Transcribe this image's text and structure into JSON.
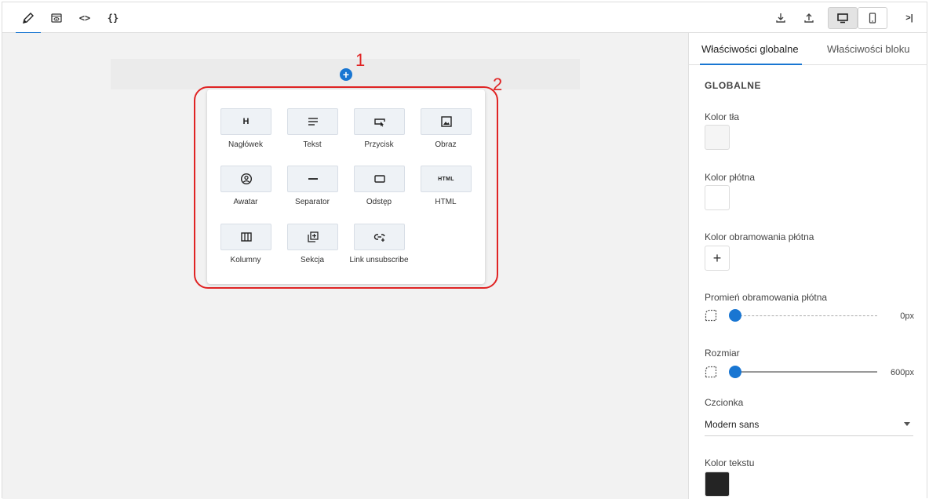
{
  "toolbar": {
    "left_buttons": [
      {
        "icon": "pencil-icon",
        "label": "edit"
      },
      {
        "icon": "eye-icon",
        "label": "preview"
      },
      {
        "icon": "html-code-icon",
        "glyph": "<>"
      },
      {
        "icon": "json-code-icon",
        "glyph": "{}"
      }
    ],
    "right_buttons": [
      {
        "icon": "download-icon"
      },
      {
        "icon": "upload-icon"
      },
      {
        "icon": "desktop-icon",
        "selected": true
      },
      {
        "icon": "mobile-icon"
      },
      {
        "icon": "collapse-panel-icon",
        "glyph": ">|"
      }
    ]
  },
  "canvas": {
    "add_symbol": "+",
    "annotations": {
      "marker_1": "1",
      "marker_2": "2"
    },
    "blocks": [
      {
        "label": "Nagłówek",
        "icon": "heading-icon",
        "glyph": "H"
      },
      {
        "label": "Tekst",
        "icon": "text-icon"
      },
      {
        "label": "Przycisk",
        "icon": "button-icon"
      },
      {
        "label": "Obraz",
        "icon": "image-icon"
      },
      {
        "label": "Awatar",
        "icon": "avatar-icon"
      },
      {
        "label": "Separator",
        "icon": "separator-icon"
      },
      {
        "label": "Odstęp",
        "icon": "spacer-icon"
      },
      {
        "label": "HTML",
        "icon": "html-icon",
        "glyph": "HTML"
      },
      {
        "label": "Kolumny",
        "icon": "columns-icon"
      },
      {
        "label": "Sekcja",
        "icon": "section-icon"
      },
      {
        "label": "Link unsubscribe",
        "icon": "unsubscribe-link-icon"
      }
    ]
  },
  "panel": {
    "tabs": [
      "Właściwości globalne",
      "Właściwości bloku"
    ],
    "active_tab": 0,
    "section_title": "GLOBALNE",
    "props": {
      "background_color_label": "Kolor tła",
      "background_color": "#f5f5f5",
      "canvas_color_label": "Kolor płótna",
      "canvas_color": "#ffffff",
      "canvas_border_color_label": "Kolor obramowania płótna",
      "canvas_border_add": "+",
      "canvas_radius_label": "Promień obramowania płótna",
      "canvas_radius_value": "0px",
      "size_label": "Rozmiar",
      "size_value": "600px",
      "font_label": "Czcionka",
      "font_value": "Modern sans",
      "text_color_label": "Kolor tekstu",
      "text_color": "#242424"
    }
  },
  "colors": {
    "accent": "#1976d2",
    "annotation": "#e02424"
  }
}
